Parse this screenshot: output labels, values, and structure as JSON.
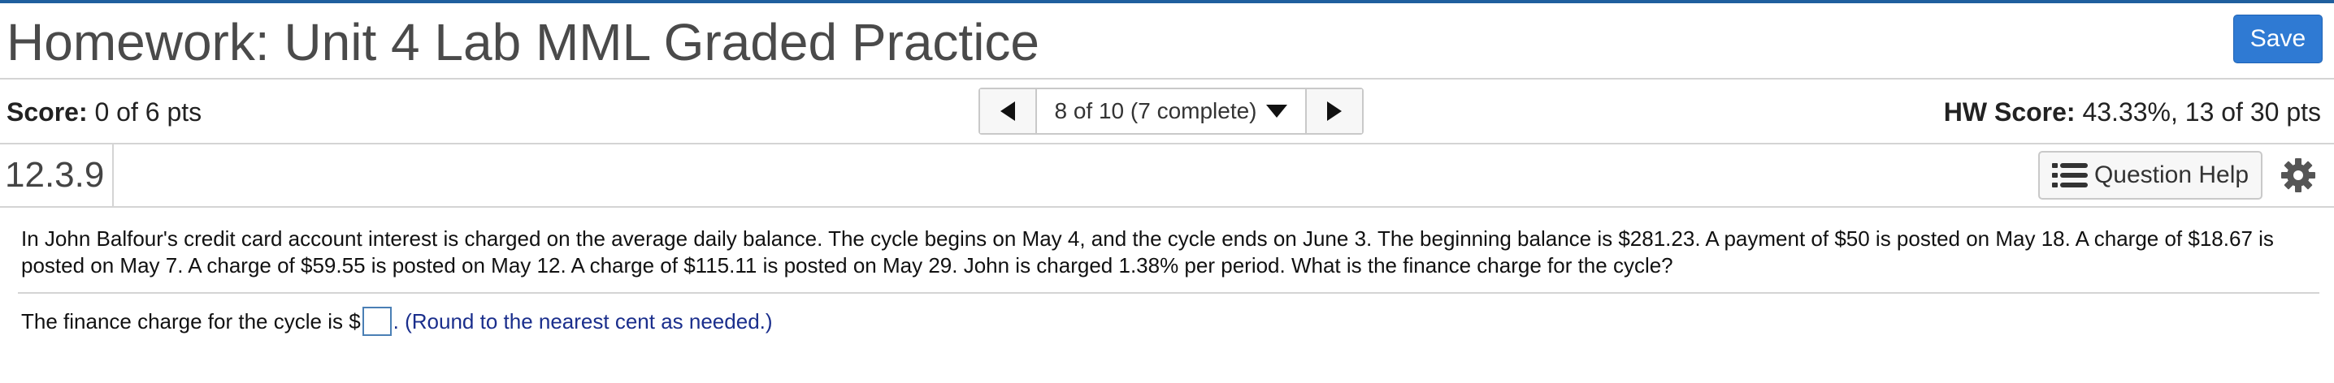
{
  "header": {
    "title": "Homework: Unit 4 Lab MML Graded Practice",
    "save_label": "Save"
  },
  "score": {
    "label": "Score:",
    "value": "0 of 6 pts",
    "hw_label": "HW Score:",
    "hw_value": "43.33%, 13 of 30 pts"
  },
  "navigation": {
    "position_label": "8 of 10 (7 complete)",
    "prev_icon": "triangle-left-icon",
    "next_icon": "triangle-right-icon",
    "dropdown_icon": "caret-down-icon"
  },
  "question": {
    "number": "12.3.9",
    "help_label": "Question Help",
    "help_icon": "list-icon",
    "settings_icon": "gear-icon",
    "text": "In John Balfour's credit card account interest is charged on the average daily balance. The cycle begins on May 4, and the cycle ends on June 3. The beginning balance is $281.23. A payment of $50 is posted on May 18. A charge of $18.67 is posted on May 7. A charge of $59.55 is posted on May 12. A charge of $115.11 is posted on May 29. John is charged 1.38% per period. What is the finance charge for the cycle?",
    "answer_prefix": "The finance charge for the cycle is $",
    "answer_value": "",
    "answer_hint": ". (Round to the nearest cent as needed.)"
  },
  "colors": {
    "accent": "#2f7ad3",
    "top_border": "#1f5f9e",
    "hint_text": "#1a2e8c",
    "divider": "#d4d4d4"
  }
}
